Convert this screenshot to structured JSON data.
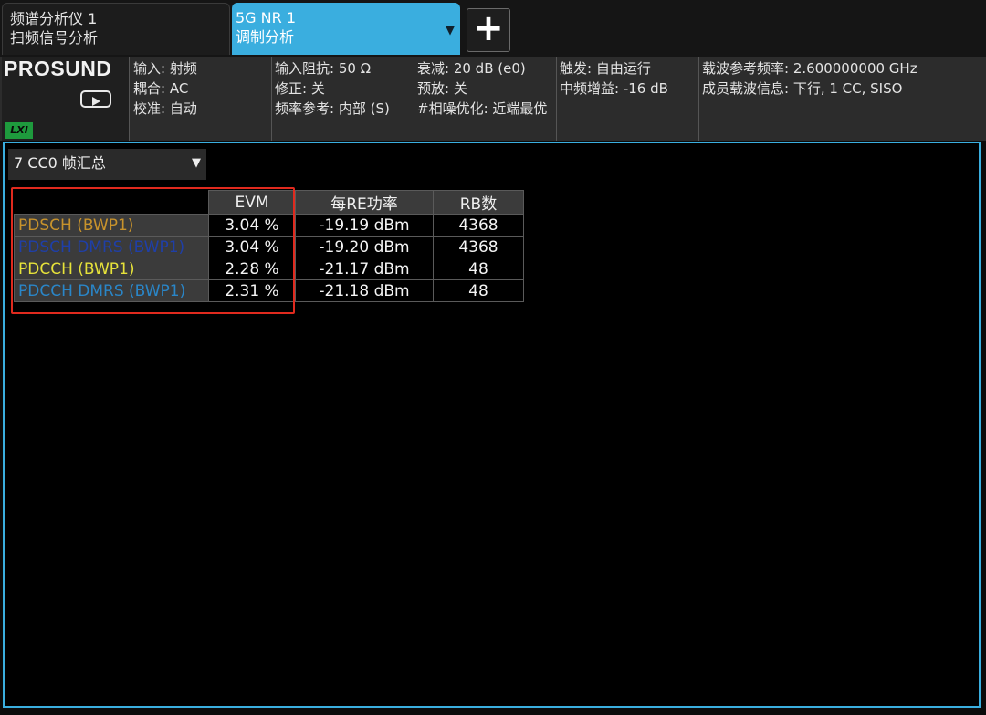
{
  "tabs": {
    "spectrum": {
      "line1": "频谱分析仪 1",
      "line2": "扫频信号分析"
    },
    "nr": {
      "line1": "5G NR 1",
      "line2": "调制分析",
      "dropdown_icon": "▼"
    },
    "add_label": "+"
  },
  "brand": {
    "name": "PROSUND",
    "lxi": "LXI"
  },
  "settings": {
    "col1": [
      "输入: 射频",
      "耦合: AC",
      "校准: 自动"
    ],
    "col2": [
      "输入阻抗: 50 Ω",
      "修正: 关",
      "频率参考: 内部 (S)"
    ],
    "col3": [
      "衰减: 20 dB (e0)",
      "预放: 关",
      "#相噪优化: 近端最优"
    ],
    "col4": [
      "触发: 自由运行",
      "中频增益: -16 dB"
    ],
    "col5": [
      "载波参考频率: 2.600000000 GHz",
      "成员载波信息: 下行, 1 CC, SISO"
    ]
  },
  "view": {
    "selected": "7 CC0 帧汇总",
    "dropdown_icon": "▼"
  },
  "table": {
    "headers": [
      "",
      "EVM",
      "每RE功率",
      "RB数"
    ],
    "rows": [
      {
        "name": "PDSCH (BWP1)",
        "color": "#c8932c",
        "evm": "3.04 %",
        "power": "-19.19 dBm",
        "rb": "4368"
      },
      {
        "name": "PDSCH DMRS (BWP1)",
        "color": "#1f3fa8",
        "evm": "3.04 %",
        "power": "-19.20 dBm",
        "rb": "4368"
      },
      {
        "name": "PDCCH (BWP1)",
        "color": "#e6e23a",
        "evm": "2.28 %",
        "power": "-21.17 dBm",
        "rb": "48"
      },
      {
        "name": "PDCCH DMRS (BWP1)",
        "color": "#2a86c8",
        "evm": "2.31 %",
        "power": "-21.18 dBm",
        "rb": "48"
      }
    ]
  },
  "colors": {
    "accent": "#3aaedf",
    "highlight": "#e02a1e",
    "lxi": "#1e9a3d"
  }
}
